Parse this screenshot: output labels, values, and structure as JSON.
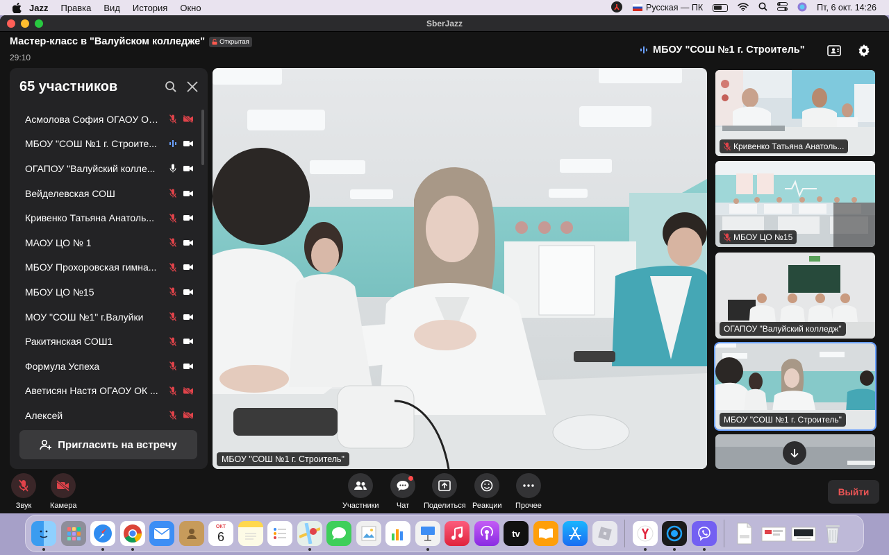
{
  "menubar": {
    "app_name": "Jazz",
    "menus": [
      "Правка",
      "Вид",
      "История",
      "Окно"
    ],
    "keyboard_layout": "Русская — ПК",
    "datetime": "Пт, 6 окт.  14:26"
  },
  "window": {
    "title": "SberJazz"
  },
  "meeting": {
    "title": "Мастер-класс в \"Валуйском колледже\"",
    "badge": "Открытая",
    "timer": "29:10",
    "active_speaker": "МБОУ \"СОШ №1 г. Строитель\""
  },
  "participants_panel": {
    "title": "65 участников",
    "items": [
      {
        "name": "Асмолова София ОГАОУ ОК ...",
        "mic": "muted",
        "cam": "off"
      },
      {
        "name": "МБОУ \"СОШ №1 г. Строите...",
        "mic": "speaking",
        "cam": "on"
      },
      {
        "name": "ОГАПОУ \"Валуйский колле...",
        "mic": "on",
        "cam": "on"
      },
      {
        "name": "Вейделевская СОШ",
        "mic": "muted",
        "cam": "on"
      },
      {
        "name": "Кривенко Татьяна Анатоль...",
        "mic": "muted",
        "cam": "on"
      },
      {
        "name": "МАОУ ЦО № 1",
        "mic": "muted",
        "cam": "on"
      },
      {
        "name": "МБОУ Прохоровская гимна...",
        "mic": "muted",
        "cam": "on"
      },
      {
        "name": "МБОУ ЦО №15",
        "mic": "muted",
        "cam": "on"
      },
      {
        "name": "МОУ \"СОШ №1\" г.Валуйки",
        "mic": "muted",
        "cam": "on"
      },
      {
        "name": "Ракитянская СОШ1",
        "mic": "muted",
        "cam": "on"
      },
      {
        "name": "Формула Успеха",
        "mic": "muted",
        "cam": "on"
      },
      {
        "name": "Аветисян Настя ОГАОУ ОК ...",
        "mic": "muted",
        "cam": "off"
      },
      {
        "name": "Алексей",
        "mic": "muted",
        "cam": "off"
      }
    ],
    "invite_label": "Пригласить на встречу"
  },
  "main_video": {
    "label": "МБОУ \"СОШ №1 г. Строитель\""
  },
  "thumbnails": [
    {
      "label": "Кривенко Татьяна Анатоль...",
      "muted": true
    },
    {
      "label": "МБОУ ЦО №15",
      "muted": true
    },
    {
      "label": "ОГАПОУ \"Валуйский колледж\"",
      "muted": false
    },
    {
      "label": "МБОУ \"СОШ №1 г. Строитель\"",
      "muted": false
    }
  ],
  "controls": {
    "sound": "Звук",
    "camera": "Камера",
    "participants": "Участники",
    "chat": "Чат",
    "share": "Поделиться",
    "reactions": "Реакции",
    "more": "Прочее",
    "exit": "Выйти"
  },
  "dock": {
    "calendar_month": "ОКТ",
    "calendar_day": "6",
    "tv_label": "tv"
  },
  "colors": {
    "accent_blue": "#6aa0ff",
    "muted_red": "#e0434a",
    "exit_red": "#ee5555",
    "panel_bg": "#232325",
    "window_bg": "#141414"
  }
}
